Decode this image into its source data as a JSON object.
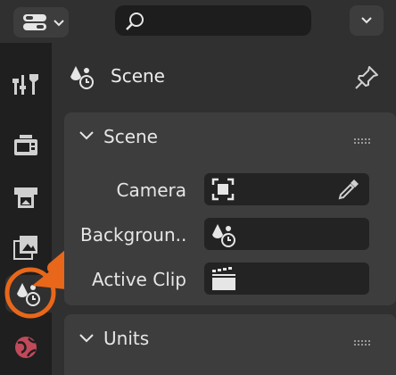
{
  "header": {
    "search_placeholder": "",
    "editor_type_icon": "properties-editor-icon",
    "menu_icon": "chevron-down-icon"
  },
  "tabs": [
    {
      "name": "tool",
      "icon": "tool-icon",
      "active": false
    },
    {
      "name": "render",
      "icon": "render-icon",
      "active": false
    },
    {
      "name": "output",
      "icon": "output-icon",
      "active": false
    },
    {
      "name": "view-layer",
      "icon": "view-layer-icon",
      "active": false
    },
    {
      "name": "scene",
      "icon": "scene-icon",
      "active": true
    },
    {
      "name": "world",
      "icon": "world-icon",
      "active": false
    }
  ],
  "context": {
    "title": "Scene",
    "icon": "scene-icon",
    "pin_icon": "pin-icon"
  },
  "scene_panel": {
    "title": "Scene",
    "fields": [
      {
        "label": "Camera",
        "icon": "camera-object-icon",
        "picker_icon": "eyedropper-icon",
        "value": ""
      },
      {
        "label": "Backgroun...",
        "icon": "scene-icon",
        "value": ""
      },
      {
        "label": "Active Clip",
        "icon": "clip-icon",
        "value": ""
      }
    ]
  },
  "units_panel": {
    "title": "Units"
  },
  "annotation": {
    "color": "#e8671a"
  }
}
